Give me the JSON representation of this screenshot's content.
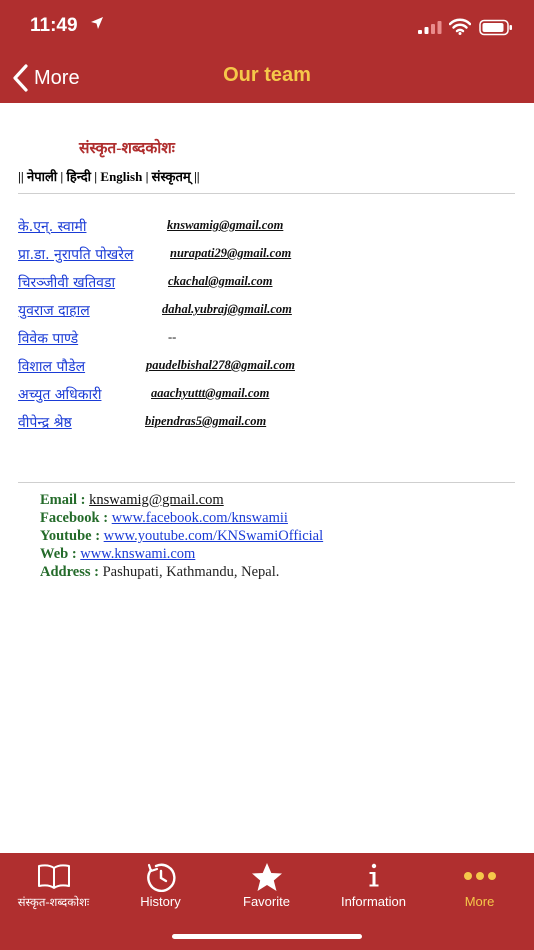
{
  "status_bar": {
    "time": "11:49"
  },
  "nav": {
    "back_label": "More",
    "title": "Our team"
  },
  "page": {
    "title": "संस्कृत-शब्दकोशः",
    "languages_line": "|| नेपाली | हिन्दी | English | संस्कृतम् ||"
  },
  "members": [
    {
      "name": "के.एन्. स्वामी",
      "email": "knswamig@gmail.com"
    },
    {
      "name": "प्रा.डा. नुरापति पोखरेल ",
      "email": "nurapati29@gmail.com"
    },
    {
      "name": "चिरञ्जीवी खतिवडा",
      "email": "ckachal@gmail.com"
    },
    {
      "name": "युवराज दाहाल",
      "email": "dahal.yubraj@gmail.com"
    },
    {
      "name": "विवेक पाण्डे ",
      "email": "--"
    },
    {
      "name": "विशाल पौडेल",
      "email": "paudelbishal278@gmail.com"
    },
    {
      "name": "अच्युत अधिकारी ",
      "email": "aaachyuttt@gmail.com"
    },
    {
      "name": "वीपेन्द्र श्रेष्ठ ",
      "email": "bipendras5@gmail.com"
    }
  ],
  "contact": {
    "email_label": "Email :",
    "email": "knswamig@gmail.com",
    "facebook_label": "Facebook :",
    "facebook": "www.facebook.com/knswamii ",
    "youtube_label": "Youtube :",
    "youtube": "www.youtube.com/KNSwamiOfficial ",
    "web_label": "Web :",
    "web": "www.knswami.com",
    "address_label": "Address :",
    "address": "Pashupati, Kathmandu, Nepal."
  },
  "tabs": [
    {
      "label": "संस्कृत-शब्दकोशः",
      "icon": "book-icon"
    },
    {
      "label": "History",
      "icon": "history-icon"
    },
    {
      "label": "Favorite",
      "icon": "star-icon"
    },
    {
      "label": "Information",
      "icon": "info-icon"
    },
    {
      "label": "More",
      "icon": "more-dots-icon",
      "active": true
    }
  ],
  "colors": {
    "brand_red": "#b02f2f",
    "accent_yellow": "#f5c84a",
    "link_blue": "#1a3bd6",
    "label_green": "#246b2a"
  }
}
